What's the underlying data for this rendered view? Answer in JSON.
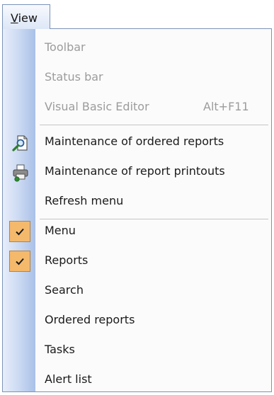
{
  "menubar": {
    "view_label_first": "V",
    "view_label_rest": "iew"
  },
  "menu": {
    "items": [
      {
        "label": "Toolbar",
        "enabled": false
      },
      {
        "label": "Status bar",
        "enabled": false
      },
      {
        "label": "Visual Basic Editor",
        "shortcut": "Alt+F11",
        "enabled": false
      },
      {
        "label": "Maintenance of ordered reports",
        "icon": "search-document-icon",
        "enabled": true
      },
      {
        "label": "Maintenance of report printouts",
        "icon": "printer-icon",
        "enabled": true
      },
      {
        "label": "Refresh menu",
        "enabled": true
      },
      {
        "label": "Menu",
        "checked": true,
        "enabled": true
      },
      {
        "label": "Reports",
        "checked": true,
        "enabled": true
      },
      {
        "label": "Search",
        "enabled": true
      },
      {
        "label": "Ordered reports",
        "enabled": true
      },
      {
        "label": "Tasks",
        "enabled": true
      },
      {
        "label": "Alert list",
        "enabled": true
      }
    ]
  },
  "colors": {
    "check_bg": "#f5b96b",
    "gutter": "#c8d7f1",
    "disabled_text": "#9c9c9c"
  }
}
